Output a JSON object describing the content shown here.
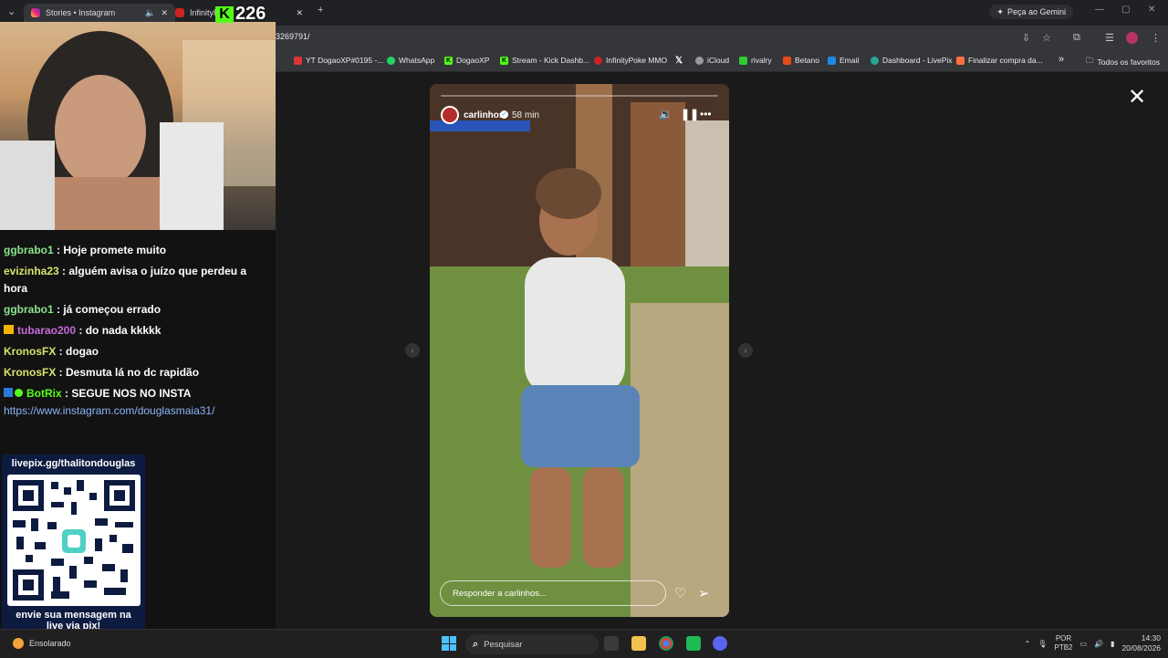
{
  "tabs": [
    {
      "label": "Stories • Instagram",
      "active": true
    },
    {
      "label": "InfinityP",
      "active": false
    }
  ],
  "gemini_button": "Peça ao Gemini",
  "url": "3269791/",
  "bookmarks": [
    {
      "label": "YT DogaoXP#0195 -...",
      "icon_color": "#d33"
    },
    {
      "label": "WhatsApp",
      "icon_color": "#25d366"
    },
    {
      "label": "DogaoXP",
      "icon_color": "#53fc18"
    },
    {
      "label": "Stream - Kick Dashb...",
      "icon_color": "#53fc18"
    },
    {
      "label": "InfinityPoke MMO",
      "icon_color": "#c22"
    },
    {
      "label": "",
      "icon_color": "#fff"
    },
    {
      "label": "iCloud",
      "icon_color": "#999"
    },
    {
      "label": "rivalry",
      "icon_color": "#3c3"
    },
    {
      "label": "Betano",
      "icon_color": "#e64a19"
    },
    {
      "label": "Email",
      "icon_color": "#1e88e5"
    },
    {
      "label": "Dashboard - LivePix",
      "icon_color": "#26a69a"
    },
    {
      "label": "Finalizar compra da...",
      "icon_color": "#ff7043"
    }
  ],
  "bookmarks_overflow": "»",
  "all_bookmarks": "Todos os favoritos",
  "kick_viewers": "226",
  "chat": [
    {
      "user": "ggbrabo1",
      "color": "#8be38b",
      "text": "Hoje promete muito",
      "badge": ""
    },
    {
      "user": "evizinha23",
      "color": "#d9e36a",
      "text": "alguém avisa o juízo que perdeu a hora",
      "badge": ""
    },
    {
      "user": "ggbrabo1",
      "color": "#8be38b",
      "text": "já começou errado",
      "badge": ""
    },
    {
      "user": "tubarao200",
      "color": "#c66bdc",
      "text": "do nada kkkkk",
      "badge": "crown"
    },
    {
      "user": "KronosFX",
      "color": "#d9e36a",
      "text": "dogao",
      "badge": ""
    },
    {
      "user": "KronosFX",
      "color": "#d9e36a",
      "text": "Desmuta lá no dc rapidão",
      "badge": ""
    },
    {
      "user": "BotRix",
      "color": "#53fc18",
      "text": "SEGUE NOS NO INSTA",
      "badge": "bot"
    }
  ],
  "chat_link": "https://www.instagram.com/douglasmaia31/",
  "qr": {
    "header": "livepix.gg/thalitondouglas",
    "footer_line1": "envie sua mensagem na",
    "footer_line2": "live via pix!"
  },
  "story": {
    "username": "carlinhos",
    "time": "58 min",
    "reply_placeholder": "Responder a carlinhos..."
  },
  "icons": {
    "close": "close-icon",
    "mute": "speaker-icon",
    "pause": "pause-icon",
    "more": "more-icon",
    "like": "heart-icon",
    "share": "send-icon"
  },
  "taskbar": {
    "weather": "Ensolarado",
    "search_placeholder": "Pesquisar",
    "lang_line1": "POR",
    "lang_line2": "PTB2",
    "time": "14:30",
    "date": "20/08/2026"
  }
}
